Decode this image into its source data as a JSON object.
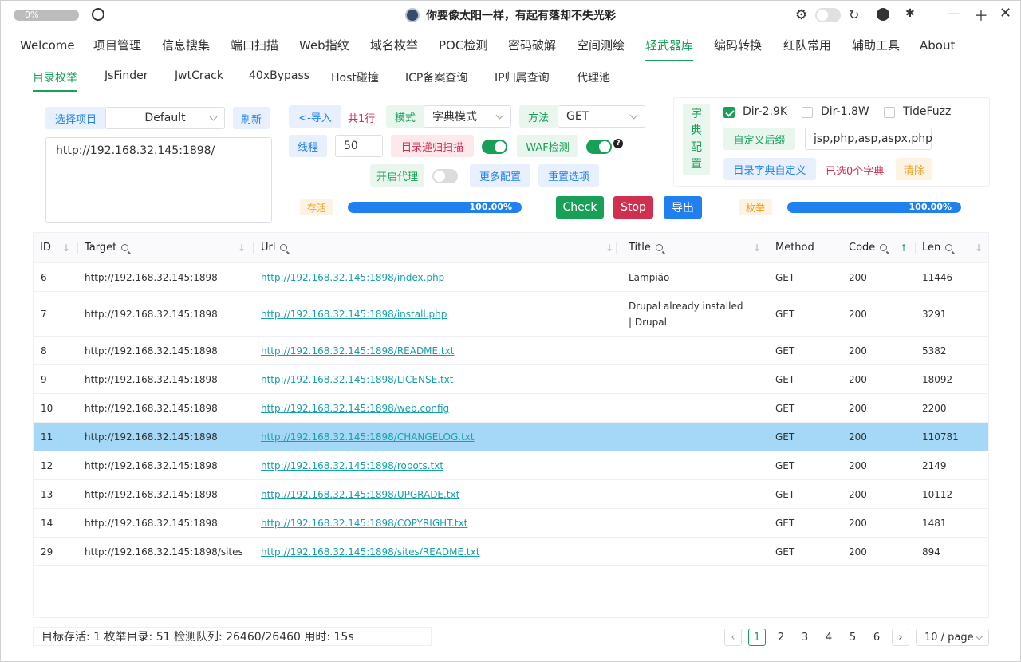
{
  "titlebar": {
    "progress": "0%",
    "title": "你要像太阳一样，有起有落却不失光彩",
    "icons": [
      "gear-icon",
      "theme-toggle",
      "refresh-icon",
      "github-icon",
      "bug-icon",
      "minimize-icon",
      "maximize-icon",
      "close-icon"
    ]
  },
  "menu": [
    "Welcome",
    "项目管理",
    "信息搜集",
    "端口扫描",
    "Web指纹",
    "域名枚举",
    "POC检测",
    "密码破解",
    "空间测绘",
    "轻武器库",
    "编码转换",
    "红队常用",
    "辅助工具",
    "About"
  ],
  "active_menu": "轻武器库",
  "subtabs": [
    "目录枚举",
    "JsFinder",
    "JwtCrack",
    "40xBypass",
    "Host碰撞",
    "ICP备案查询",
    "IP归属查询",
    "代理池"
  ],
  "active_subtab": "目录枚举",
  "form": {
    "select_project_label": "选择项目",
    "project_value": "Default",
    "refresh_label": "刷新",
    "target_text": "http://192.168.32.145:1898/",
    "import_label": "<-导入",
    "line_count": "共1行",
    "mode_label": "模式",
    "mode_value": "字典模式",
    "method_label": "方法",
    "method_value": "GET",
    "threads_label": "线程",
    "threads_value": "50",
    "recursive_label": "目录递归扫描",
    "waf_label": "WAF检测",
    "proxy_label": "开启代理",
    "more_config_label": "更多配置",
    "reset_label": "重置选项",
    "alive_tag": "存活",
    "alive_progress": "100.00%",
    "check_label": "Check",
    "stop_label": "Stop",
    "export_label": "导出",
    "enum_tag": "枚举",
    "enum_progress": "100.00%"
  },
  "dict": {
    "label_chars": [
      "字",
      "典",
      "配",
      "置"
    ],
    "options": [
      {
        "label": "Dir-2.9K",
        "checked": true
      },
      {
        "label": "Dir-1.8W",
        "checked": false
      },
      {
        "label": "TideFuzz",
        "checked": false
      }
    ],
    "custom_suffix_label": "自定义后缀",
    "suffix_value": "jsp,php,asp,aspx,php",
    "custom_dict_label": "目录字典自定义",
    "selected_text": "已选0个字典",
    "clear_label": "清除"
  },
  "table": {
    "columns": [
      "ID",
      "Target",
      "Url",
      "Title",
      "Method",
      "Code",
      "Len"
    ],
    "rows": [
      {
        "id": "6",
        "target": "http://192.168.32.145:1898",
        "url": "http://192.168.32.145:1898/index.php",
        "title": "Lampião",
        "method": "GET",
        "code": "200",
        "len": "11446"
      },
      {
        "id": "7",
        "target": "http://192.168.32.145:1898",
        "url": "http://192.168.32.145:1898/install.php",
        "title": "Drupal already installed | Drupal",
        "method": "GET",
        "code": "200",
        "len": "3291"
      },
      {
        "id": "8",
        "target": "http://192.168.32.145:1898",
        "url": "http://192.168.32.145:1898/README.txt",
        "title": "",
        "method": "GET",
        "code": "200",
        "len": "5382"
      },
      {
        "id": "9",
        "target": "http://192.168.32.145:1898",
        "url": "http://192.168.32.145:1898/LICENSE.txt",
        "title": "",
        "method": "GET",
        "code": "200",
        "len": "18092"
      },
      {
        "id": "10",
        "target": "http://192.168.32.145:1898",
        "url": "http://192.168.32.145:1898/web.config",
        "title": "",
        "method": "GET",
        "code": "200",
        "len": "2200"
      },
      {
        "id": "11",
        "target": "http://192.168.32.145:1898",
        "url": "http://192.168.32.145:1898/CHANGELOG.txt",
        "title": "",
        "method": "GET",
        "code": "200",
        "len": "110781",
        "selected": true
      },
      {
        "id": "12",
        "target": "http://192.168.32.145:1898",
        "url": "http://192.168.32.145:1898/robots.txt",
        "title": "",
        "method": "GET",
        "code": "200",
        "len": "2149"
      },
      {
        "id": "13",
        "target": "http://192.168.32.145:1898",
        "url": "http://192.168.32.145:1898/UPGRADE.txt",
        "title": "",
        "method": "GET",
        "code": "200",
        "len": "10112"
      },
      {
        "id": "14",
        "target": "http://192.168.32.145:1898",
        "url": "http://192.168.32.145:1898/COPYRIGHT.txt",
        "title": "",
        "method": "GET",
        "code": "200",
        "len": "1481"
      },
      {
        "id": "29",
        "target": "http://192.168.32.145:1898/sites",
        "url": "http://192.168.32.145:1898/sites/README.txt",
        "title": "",
        "method": "GET",
        "code": "200",
        "len": "894"
      }
    ]
  },
  "footer": {
    "status": "目标存活: 1    枚举目录: 51    检测队列: 26460/26460    用时: 15s",
    "pages": [
      "1",
      "2",
      "3",
      "4",
      "5",
      "6"
    ],
    "current_page": "1",
    "page_size": "10 / page"
  },
  "colors": {
    "accent": "#18a058",
    "blue": "#2080f0",
    "red": "#d03050",
    "orange": "#f0a020",
    "selected_row": "#a5d7f7"
  }
}
